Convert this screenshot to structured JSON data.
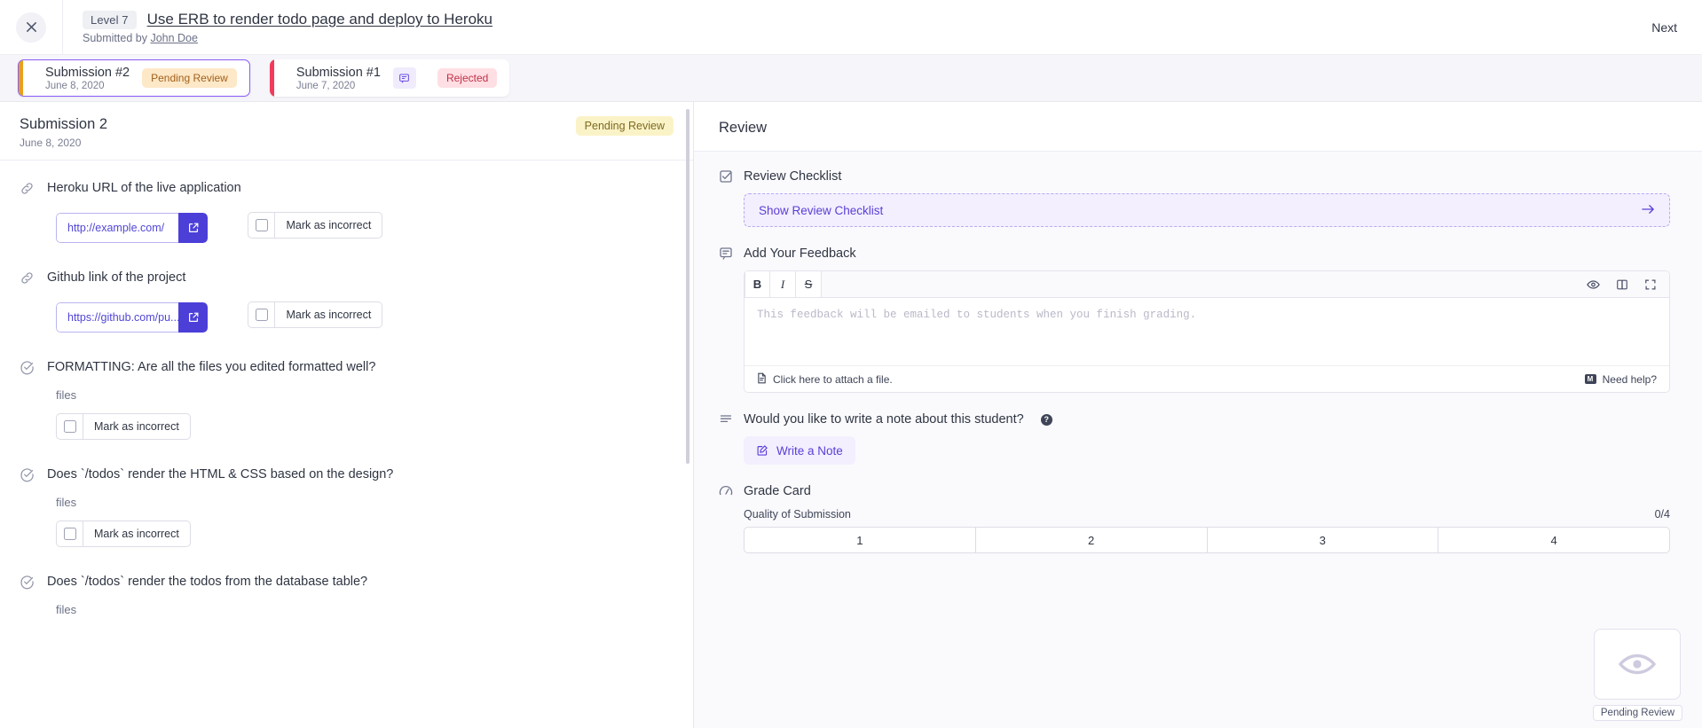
{
  "topbar": {
    "close_icon": "close-icon",
    "level_chip": "Level 7",
    "assignment_title": "Use ERB to render todo page and deploy to Heroku",
    "submitted_prefix": "Submitted by",
    "student_name": "John Doe",
    "next_label": "Next"
  },
  "submission_tabs": [
    {
      "name": "Submission #2",
      "date": "June 8, 2020",
      "status": "Pending Review",
      "status_kind": "pending",
      "stripe_color": "#e8a01b",
      "active": true,
      "has_comment_icon": false
    },
    {
      "name": "Submission #1",
      "date": "June 7, 2020",
      "status": "Rejected",
      "status_kind": "rejected",
      "stripe_color": "#f23b5c",
      "active": false,
      "has_comment_icon": true
    }
  ],
  "left_panel": {
    "heading": "Submission 2",
    "date": "June 8, 2020",
    "status_badge": "Pending Review",
    "mark_label": "Mark as incorrect",
    "questions": [
      {
        "icon": "link-icon",
        "title": "Heroku URL of the live application",
        "type": "url",
        "value": "http://example.com/",
        "open_icon": "external-link-icon"
      },
      {
        "icon": "link-icon",
        "title": "Github link of the project",
        "type": "url",
        "value": "https://github.com/pu...",
        "open_icon": "external-link-icon"
      },
      {
        "icon": "check-circle-icon",
        "title": "FORMATTING: Are all the files you edited formatted well?",
        "type": "text",
        "value": "files"
      },
      {
        "icon": "check-circle-icon",
        "title": "Does `/todos` render the HTML & CSS based on the design?",
        "type": "text",
        "value": "files"
      },
      {
        "icon": "check-circle-icon",
        "title": "Does `/todos` render the todos from the database table?",
        "type": "text",
        "value": "files"
      }
    ]
  },
  "right_panel": {
    "heading": "Review",
    "checklist": {
      "icon": "checkbox-checked-icon",
      "section_title": "Review Checklist",
      "button_label": "Show Review Checklist",
      "arrow_icon": "arrow-right-icon"
    },
    "feedback": {
      "icon": "comment-icon",
      "section_title": "Add Your Feedback",
      "toolbar_left": [
        {
          "name": "bold-icon",
          "label": "B"
        },
        {
          "name": "italic-icon",
          "label": "I"
        },
        {
          "name": "strikethrough-icon",
          "label": "S"
        }
      ],
      "toolbar_right": [
        {
          "name": "eye-icon"
        },
        {
          "name": "split-view-icon"
        },
        {
          "name": "fullscreen-icon"
        }
      ],
      "placeholder": "This feedback will be emailed to students when you finish grading.",
      "value": "",
      "attach_label": "Click here to attach a file.",
      "attach_icon": "attachment-file-icon",
      "help_label": "Need help?",
      "help_icon": "markdown-icon",
      "help_badge": "M"
    },
    "note": {
      "icon": "note-lines-icon",
      "question": "Would you like to write a note about this student?",
      "help_icon": "question-mark-icon",
      "button_label": "Write a Note",
      "button_icon": "pencil-square-icon"
    },
    "grade_card": {
      "icon": "gauge-icon",
      "section_title": "Grade Card",
      "criterion_label": "Quality of Submission",
      "score": "0/4",
      "scale": [
        "1",
        "2",
        "3",
        "4"
      ]
    },
    "float_preview": {
      "icon": "eye-icon",
      "label": "Pending Review"
    }
  },
  "colors": {
    "accent_purple": "#5b3ed6",
    "button_blue": "#4c3fd8",
    "pending_bg": "#fde8c8",
    "pending_text": "#a2601b",
    "rejected_bg": "#ffdfe4",
    "rejected_text": "#c03148",
    "badge_yellow_bg": "#fbf3c8"
  }
}
